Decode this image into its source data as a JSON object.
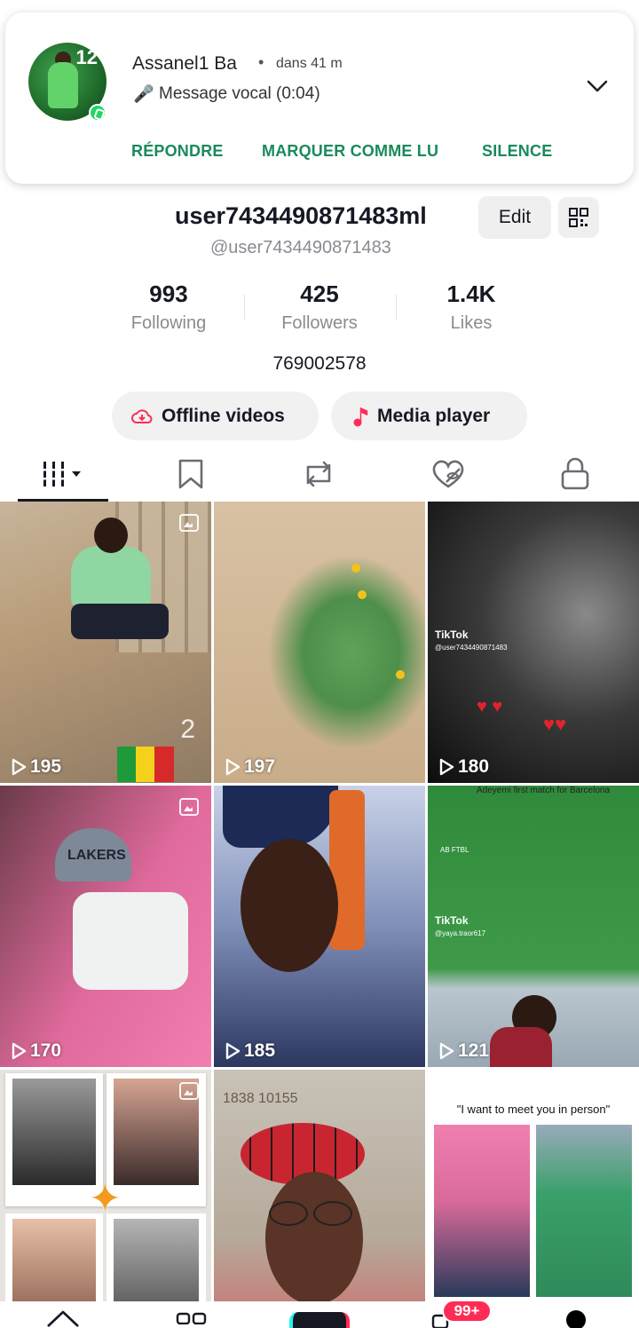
{
  "notification": {
    "sender": "Assanel1 Ba",
    "separator": "•",
    "time": "dans 41 m",
    "message_icon": "🎤",
    "message": "Message vocal (0:04)",
    "avatar_number": "12",
    "actions": [
      "RÉPONDRE",
      "MARQUER COMME LU",
      "SILENCE"
    ],
    "app_icon": "whatsapp-icon"
  },
  "profile": {
    "display_name": "user7434490871483ml",
    "handle": "@user7434490871483",
    "edit_label": "Edit",
    "bio": "769002578",
    "stats": [
      {
        "value": "993",
        "label": "Following"
      },
      {
        "value": "425",
        "label": "Followers"
      },
      {
        "value": "1.4K",
        "label": "Likes"
      }
    ],
    "buttons": {
      "offline": "Offline videos",
      "media": "Media player"
    }
  },
  "tabs": [
    {
      "name": "videos",
      "icon": "grid-icon",
      "active": true
    },
    {
      "name": "favorites",
      "icon": "bookmark-icon"
    },
    {
      "name": "reposts",
      "icon": "repost-icon"
    },
    {
      "name": "liked",
      "icon": "hidden-heart-icon"
    },
    {
      "name": "private",
      "icon": "lock-icon"
    }
  ],
  "videos": [
    {
      "views": "195",
      "overlay": "2"
    },
    {
      "views": "197"
    },
    {
      "views": "180",
      "overlay_brand": "TikTok",
      "overlay_user": "@user7434490871483"
    },
    {
      "views": "170",
      "overlay": "LAKERS"
    },
    {
      "views": "185"
    },
    {
      "views": "121",
      "overlay_title": "Adeyemi first match for Barcelona",
      "overlay_brand": "TikTok",
      "overlay_user": "@yaya.traor617",
      "overlay_tag": "AB FTBL"
    },
    {
      "views": ""
    },
    {
      "views": "",
      "overlay": "1838 10155"
    },
    {
      "views": "",
      "quote": "\"I want to meet you in person\""
    }
  ],
  "bottom_nav": {
    "inbox_badge": "99+"
  },
  "colors": {
    "accent_green": "#1a8a5a",
    "tiktok_red": "#fe2c55",
    "tiktok_cyan": "#25f4ee"
  }
}
